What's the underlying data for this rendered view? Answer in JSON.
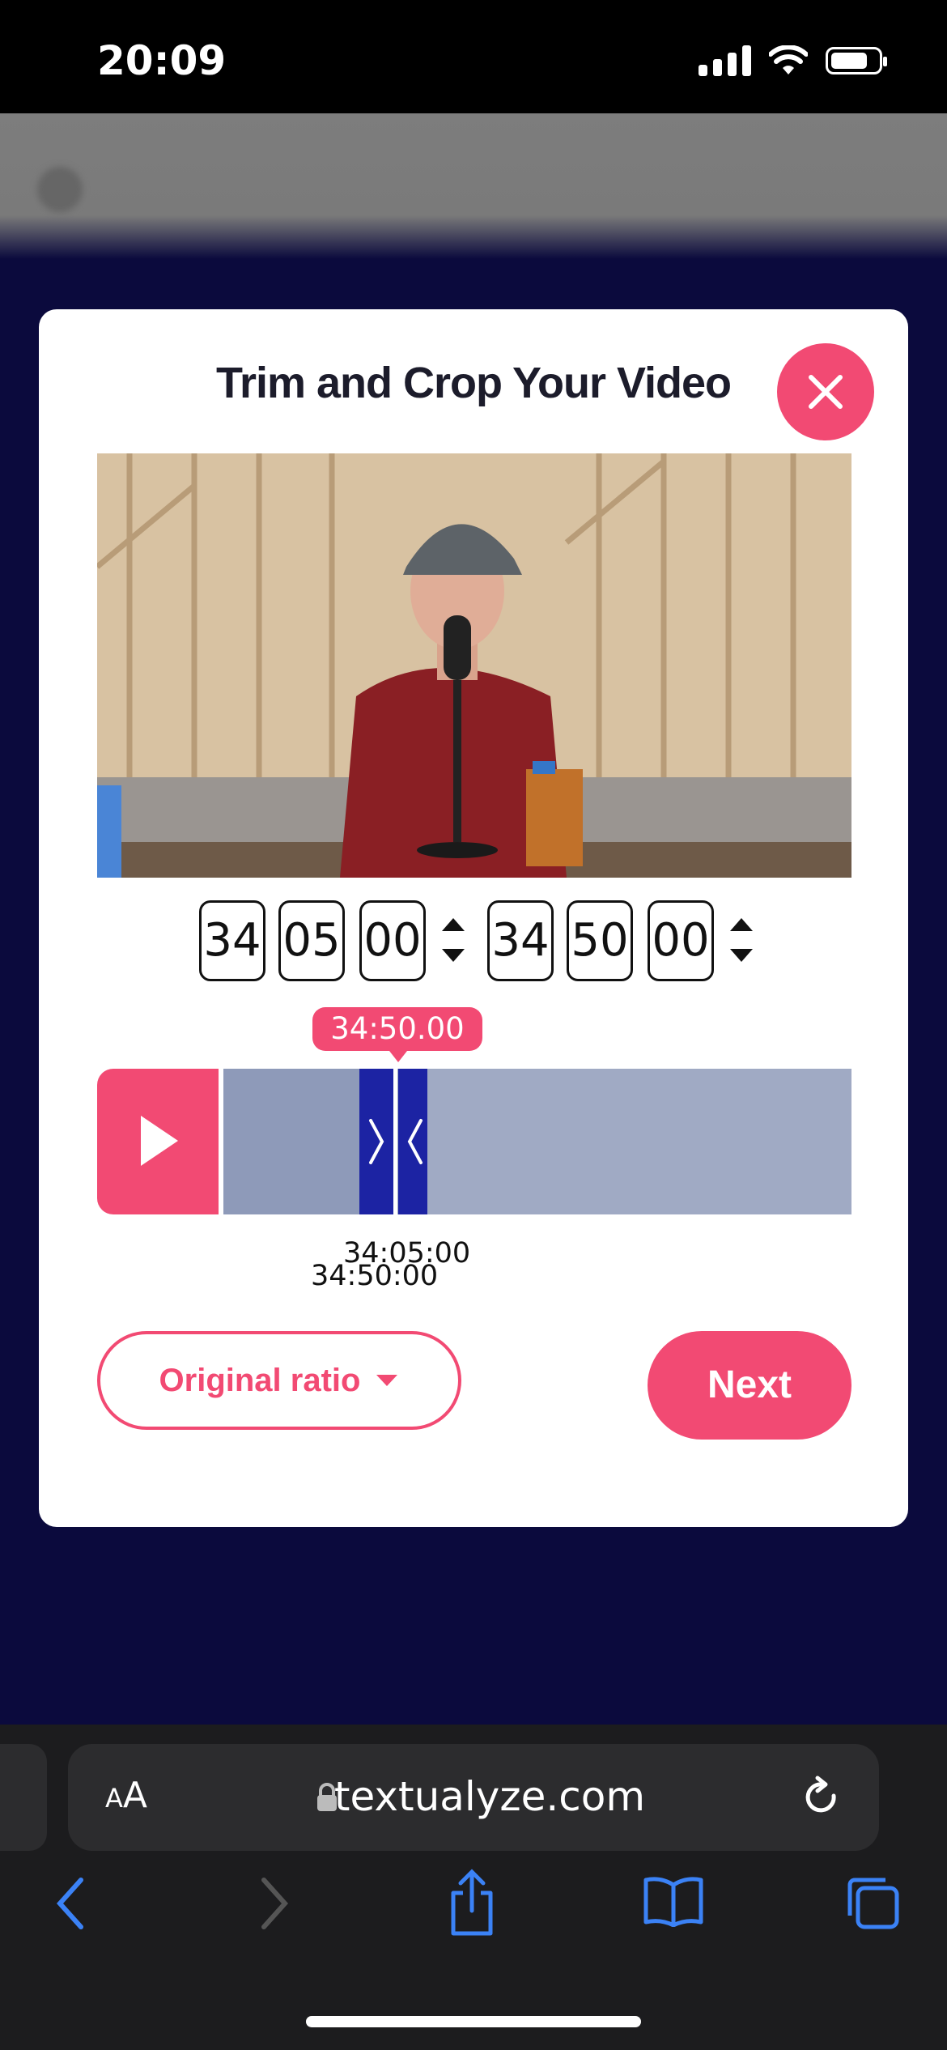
{
  "status_bar": {
    "time": "20:09"
  },
  "modal": {
    "title": "Trim and Crop Your Video",
    "start_time": {
      "minutes": "34",
      "seconds": "05",
      "frames": "00"
    },
    "end_time": {
      "minutes": "34",
      "seconds": "50",
      "frames": "00"
    },
    "playhead_tooltip": "34:50.00",
    "timeline": {
      "start_label": "34:05:00",
      "end_label": "34:50:00"
    },
    "ratio_label": "Original ratio",
    "next_label": "Next"
  },
  "browser": {
    "url": "textualyze.com",
    "text_size_small": "A",
    "text_size_large": "A"
  },
  "colors": {
    "accent": "#f24a73",
    "handle": "#1c23a3",
    "page_bg": "#0b0a3d"
  }
}
